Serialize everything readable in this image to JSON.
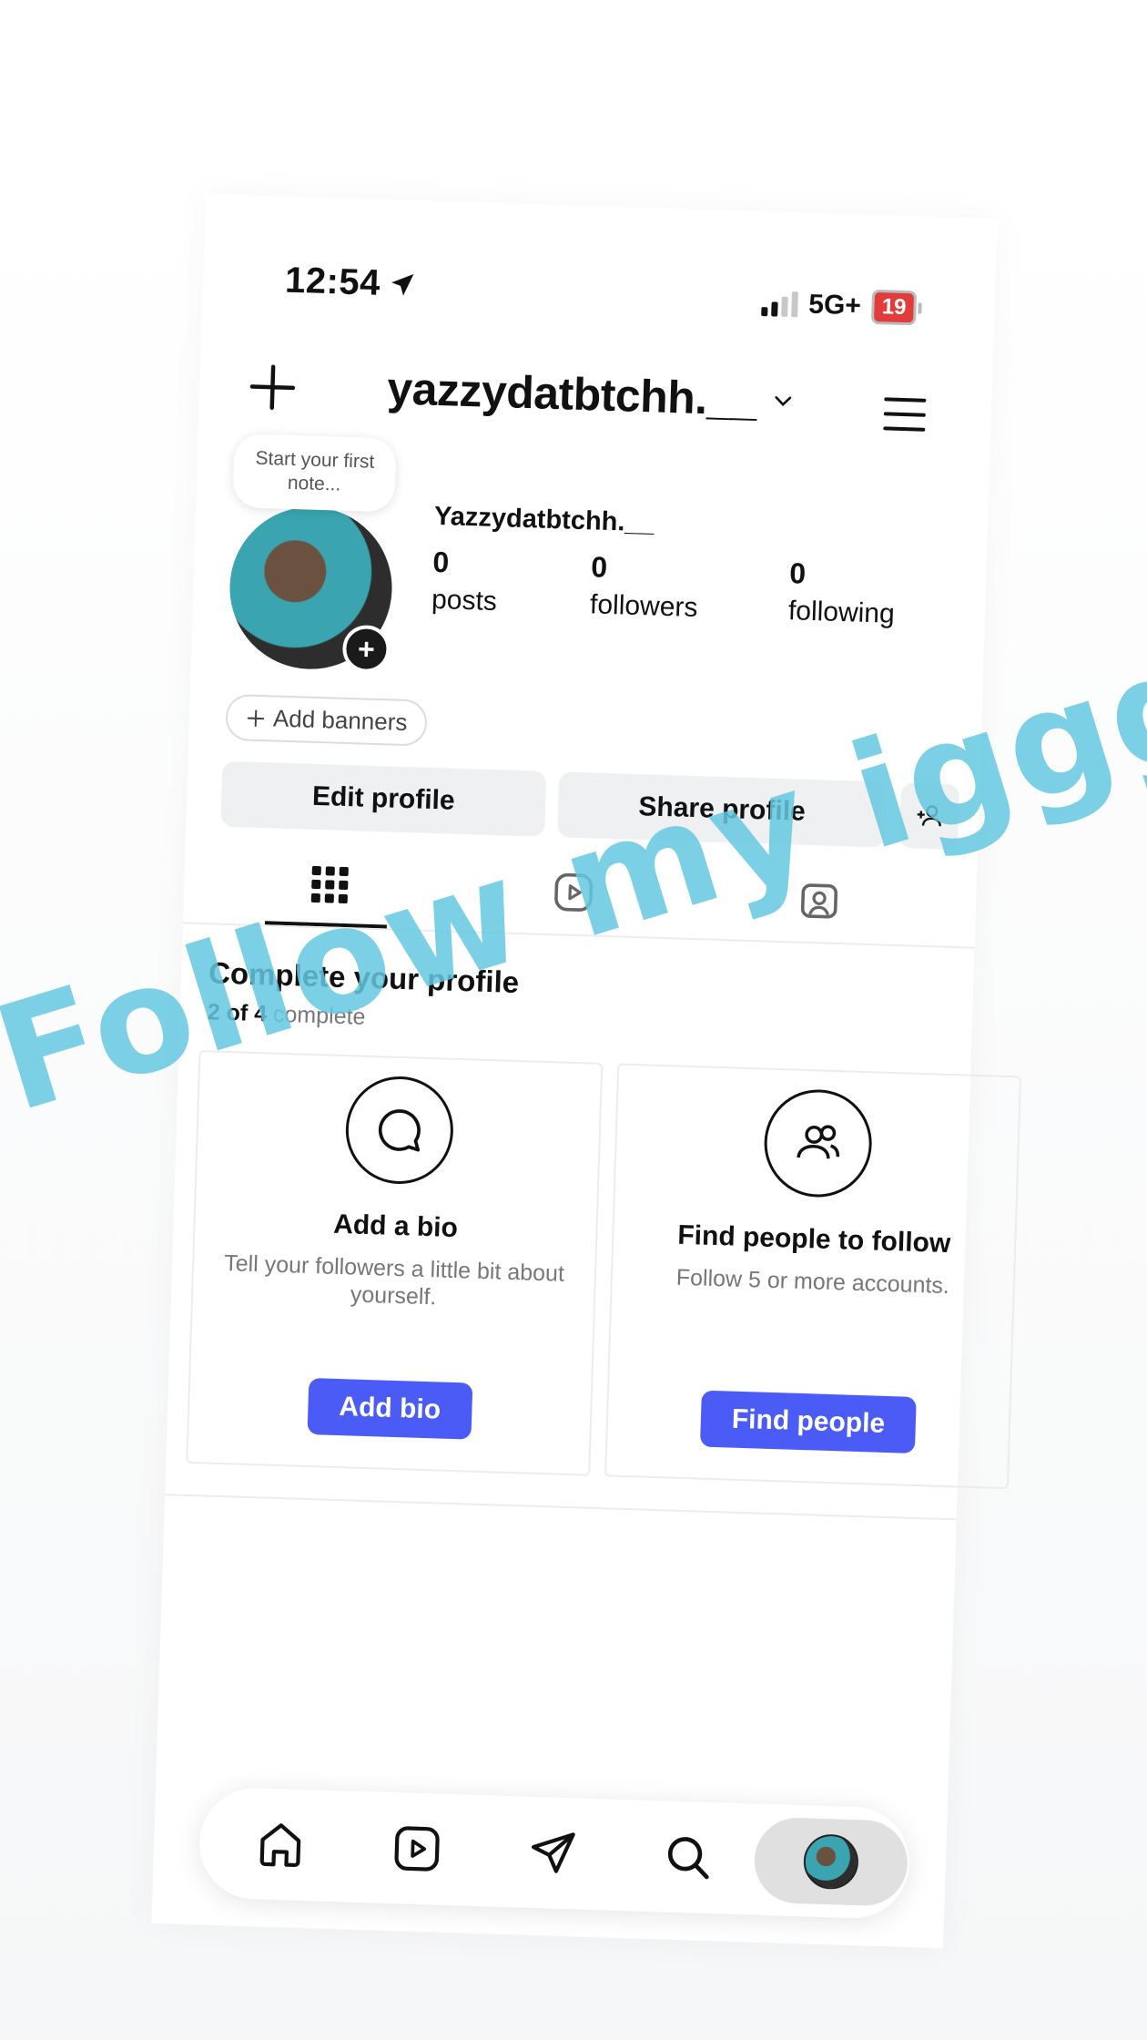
{
  "status_bar": {
    "time": "12:54",
    "network": "5G+",
    "battery": "19"
  },
  "header": {
    "username": "yazzydatbtchh.__"
  },
  "profile": {
    "note_placeholder": "Start your first note...",
    "display_name": "Yazzydatbtchh.__",
    "stats": [
      {
        "value": "0",
        "label": "posts"
      },
      {
        "value": "0",
        "label": "followers"
      },
      {
        "value": "0",
        "label": "following"
      }
    ],
    "add_banners_label": "Add banners",
    "edit_profile_label": "Edit profile",
    "share_profile_label": "Share profile"
  },
  "tabs": {
    "selected": "grid",
    "items": [
      "grid-icon",
      "reels-icon",
      "tagged-icon"
    ]
  },
  "complete_profile": {
    "title": "Complete your profile",
    "progress_prefix": "2 of 4",
    "progress_suffix": "complete",
    "progress": {
      "done": 2,
      "total": 4
    },
    "cards": [
      {
        "icon": "speech-bubble-icon",
        "title": "Add a bio",
        "description": "Tell your followers a little bit about yourself.",
        "button": "Add bio"
      },
      {
        "icon": "people-icon",
        "title": "Find people to follow",
        "description": "Follow 5 or more accounts.",
        "button": "Find people"
      }
    ]
  },
  "bottom_nav": {
    "items": [
      "home-icon",
      "reels-icon",
      "send-icon",
      "search-icon",
      "profile-avatar"
    ],
    "selected": "profile-avatar"
  },
  "watermark": "Follow my igggg",
  "colors": {
    "accent": "#4a5cf5",
    "watermark": "#64c8e1",
    "battery_low": "#e23b3b"
  }
}
